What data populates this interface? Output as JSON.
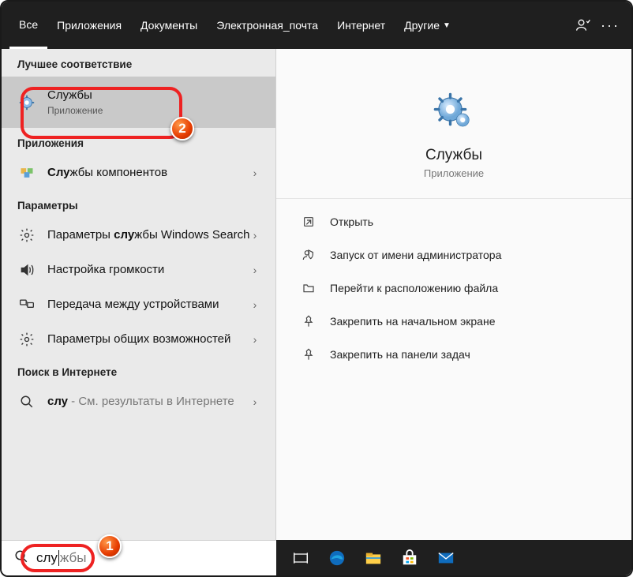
{
  "topbar": {
    "tabs": [
      "Все",
      "Приложения",
      "Документы",
      "Электронная_почта",
      "Интернет"
    ],
    "more_label": "Другие"
  },
  "left": {
    "best_match_header": "Лучшее соответствие",
    "best": {
      "title": "Службы",
      "subtitle": "Приложение"
    },
    "apps_header": "Приложения",
    "apps": [
      {
        "label_pre": "Слу",
        "label_post": "жбы компонентов"
      }
    ],
    "settings_header": "Параметры",
    "settings": [
      {
        "label_pre_plain": "Параметры ",
        "label_bold": "слу",
        "label_post": "жбы Windows Search"
      },
      {
        "label": "Настройка громкости"
      },
      {
        "label": "Передача между устройствами"
      },
      {
        "label": "Параметры общих возможностей"
      }
    ],
    "web_header": "Поиск в Интернете",
    "web": {
      "query": "слу",
      "hint": " - См. результаты в Интернете"
    }
  },
  "preview": {
    "title": "Службы",
    "subtitle": "Приложение"
  },
  "actions": [
    {
      "icon": "open",
      "label": "Открыть"
    },
    {
      "icon": "admin",
      "label": "Запуск от имени администратора"
    },
    {
      "icon": "folder",
      "label": "Перейти к расположению файла"
    },
    {
      "icon": "pin-start",
      "label": "Закрепить на начальном экране"
    },
    {
      "icon": "pin-task",
      "label": "Закрепить на панели задач"
    }
  ],
  "search": {
    "typed": "слу",
    "placeholder_rest": "жбы"
  },
  "markers": {
    "m1": "1",
    "m2": "2"
  }
}
